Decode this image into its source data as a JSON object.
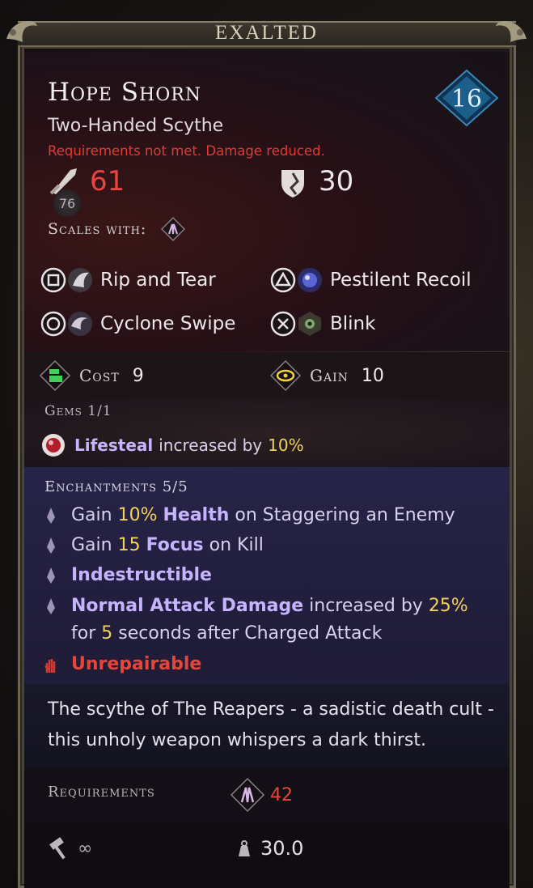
{
  "tier": "EXALTED",
  "item": {
    "name": "Hope Shorn",
    "type": "Two-Handed Scythe",
    "warning": "Requirements not met. Damage reduced.",
    "level": "16"
  },
  "stats": {
    "damage": "61",
    "damage_base": "76",
    "defense": "30"
  },
  "scales_with": {
    "label": "Scales with:",
    "icon": "faith-hands-icon"
  },
  "abilities": [
    {
      "button": "square",
      "name": "Rip and Tear"
    },
    {
      "button": "triangle",
      "name": "Pestilent Recoil"
    },
    {
      "button": "circle",
      "name": "Cyclone Swipe"
    },
    {
      "button": "cross",
      "name": "Blink"
    }
  ],
  "cost": {
    "label": "Cost",
    "value": "9"
  },
  "gain": {
    "label": "Gain",
    "value": "10"
  },
  "gems": {
    "title": "Gems 1/1",
    "stat": "Lifesteal",
    "text": "increased by",
    "value": "10%"
  },
  "enchantments": {
    "title": "Enchantments 5/5",
    "lines": [
      {
        "pre": "Gain",
        "val": "10%",
        "hl": "Health",
        "post": "on Staggering an Enemy"
      },
      {
        "pre": "Gain",
        "val": "15",
        "hl": "Focus",
        "post": "on Kill"
      },
      {
        "hl": "Indestructible"
      },
      {
        "hl": "Normal Attack Damage",
        "mid": "increased by",
        "val": "25%"
      },
      {
        "pre": "for",
        "val": "5",
        "post": "seconds after Charged Attack"
      },
      {
        "red": "Unrepairable"
      }
    ]
  },
  "description": "The scythe of The Reapers - a sadistic death cult - this unholy weapon whispers a dark thirst.",
  "requirements": {
    "label": "Requirements",
    "value": "42"
  },
  "footer": {
    "durability": "∞",
    "weight": "30.0"
  },
  "colors": {
    "damage_red": "#e54640",
    "highlight_purple": "#c6b4ff",
    "value_yellow": "#f3d25a",
    "level_blue": "#1c5f8a"
  }
}
